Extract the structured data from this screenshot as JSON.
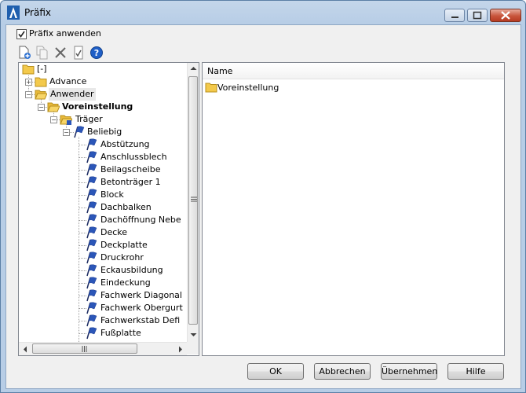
{
  "window": {
    "title": "Präfix"
  },
  "checkbox": {
    "label": "Präfix anwenden",
    "checked": true
  },
  "tree": {
    "root_label": "[-]",
    "advance": "Advance",
    "anwender": "Anwender",
    "voreinstellung": "Voreinstellung",
    "traeger": "Träger",
    "beliebig": "Beliebig",
    "items": [
      "Abstützung",
      "Anschlussblech",
      "Beilagscheibe",
      "Betonträger 1",
      "Block",
      "Dachbalken",
      "Dachöffnung Nebe",
      "Decke",
      "Deckplatte",
      "Druckrohr",
      "Eckausbildung",
      "Eindeckung",
      "Fachwerk Diagonal",
      "Fachwerk Obergurt",
      "Fachwerkstab Defi",
      "Fußplatte"
    ]
  },
  "list": {
    "column_name": "Name",
    "rows": [
      "Voreinstellung"
    ]
  },
  "buttons": {
    "ok": "OK",
    "cancel": "Abbrechen",
    "apply": "Übernehmen",
    "help": "Hilfe"
  },
  "colors": {
    "titlebar": "#b9cfe7",
    "folder": "#f3c94b",
    "flag": "#2b56b8"
  }
}
